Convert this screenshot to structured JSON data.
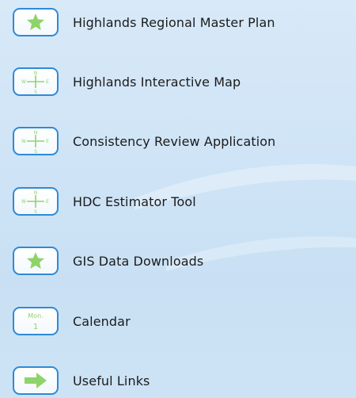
{
  "nav": {
    "items": [
      {
        "label": "Highlands Regional Master Plan",
        "icon": "star-icon"
      },
      {
        "label": "Highlands Interactive Map",
        "icon": "compass-icon"
      },
      {
        "label": "Consistency Review Application",
        "icon": "compass-icon"
      },
      {
        "label": "HDC Estimator Tool",
        "icon": "compass-icon"
      },
      {
        "label": "GIS Data Downloads",
        "icon": "star-icon"
      },
      {
        "label": "Calendar",
        "icon": "calendar-icon"
      },
      {
        "label": "Useful Links",
        "icon": "arrow-right-icon"
      }
    ],
    "calendar_icon_text": {
      "month": "Mon.",
      "day": "1"
    },
    "compass_letters": {
      "n": "N",
      "s": "S",
      "e": "E",
      "w": "W"
    }
  },
  "colors": {
    "icon_green": "#8fd36b",
    "icon_border": "#2f8ad6",
    "label_text": "#1b1b1b"
  }
}
